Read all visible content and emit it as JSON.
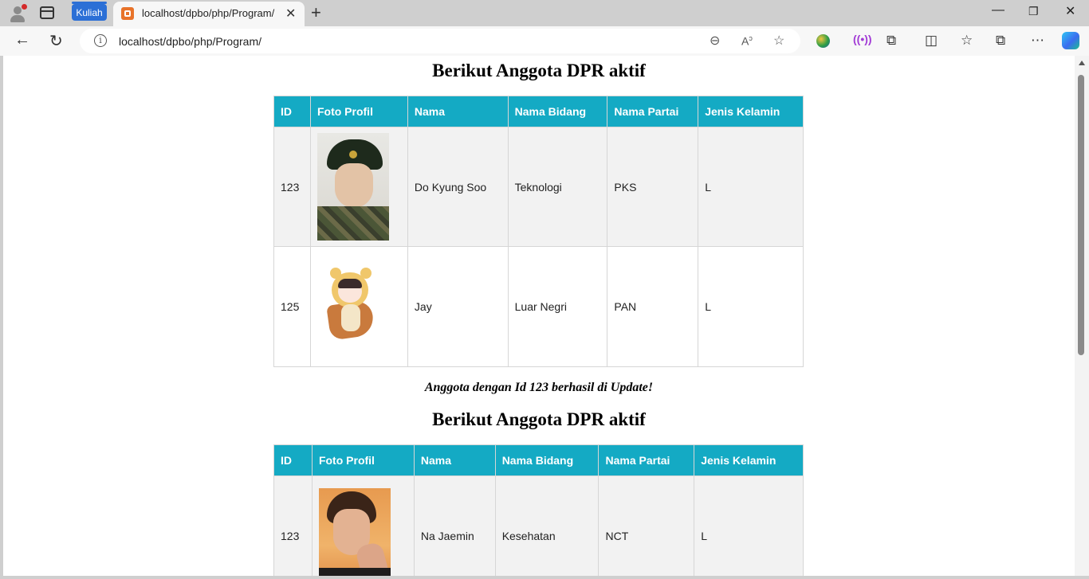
{
  "browser": {
    "tab_group_label": "Kuliah",
    "tab_title": "localhost/dpbo/php/Program/",
    "url": "localhost/dpbo/php/Program/"
  },
  "page": {
    "heading_1": "Berikut Anggota DPR aktif",
    "message": "Anggota dengan Id 123 berhasil di Update!",
    "heading_2": "Berikut Anggota DPR aktif",
    "columns": [
      "ID",
      "Foto Profil",
      "Nama",
      "Nama Bidang",
      "Nama Partai",
      "Jenis Kelamin"
    ],
    "table_1": [
      {
        "id": "123",
        "photo": "soldier-photo",
        "nama": "Do Kyung Soo",
        "bidang": "Teknologi",
        "partai": "PKS",
        "jk": "L"
      },
      {
        "id": "125",
        "photo": "cartoon-photo",
        "nama": "Jay",
        "bidang": "Luar Negri",
        "partai": "PAN",
        "jk": "L"
      }
    ],
    "table_2": [
      {
        "id": "123",
        "photo": "portrait-photo",
        "nama": "Na Jaemin",
        "bidang": "Kesehatan",
        "partai": "NCT",
        "jk": "L"
      }
    ]
  },
  "colors": {
    "header_bg": "#14aac4",
    "row_odd": "#f2f2f2",
    "tab_group": "#2b6fd6"
  }
}
